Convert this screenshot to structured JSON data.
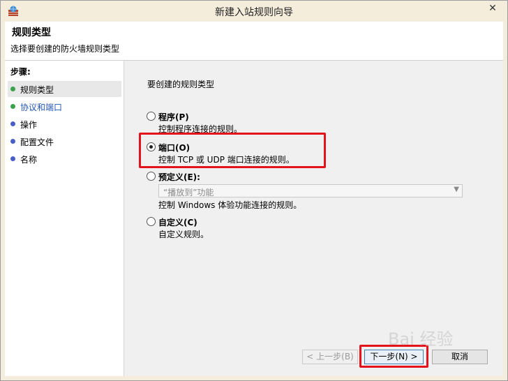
{
  "window": {
    "title": "新建入站规则向导",
    "close_glyph": "✕"
  },
  "header": {
    "title": "规则类型",
    "subtitle": "选择要创建的防火墙规则类型"
  },
  "steps": {
    "title": "步骤:",
    "items": [
      {
        "label": "规则类型",
        "dot_color": "#3aa24a"
      },
      {
        "label": "协议和端口",
        "dot_color": "#3aa24a"
      },
      {
        "label": "操作",
        "dot_color": "#4a5ec8"
      },
      {
        "label": "配置文件",
        "dot_color": "#4a5ec8"
      },
      {
        "label": "名称",
        "dot_color": "#4a5ec8"
      }
    ]
  },
  "main": {
    "heading": "要创建的规则类型",
    "options": [
      {
        "label": "程序(P)",
        "desc": "控制程序连接的规则。",
        "selected": false
      },
      {
        "label": "端口(O)",
        "desc": "控制 TCP 或 UDP 端口连接的规则。",
        "selected": true
      },
      {
        "label": "预定义(E):",
        "desc": "控制 Windows 体验功能连接的规则。",
        "selected": false
      },
      {
        "label": "自定义(C)",
        "desc": "自定义规则。",
        "selected": false
      }
    ],
    "predefined_select": {
      "value": "“播放到”功能"
    }
  },
  "buttons": {
    "back": "< 上一步(B)",
    "next": "下一步(N) >",
    "cancel": "取消"
  },
  "watermark": "Bai 经验",
  "colors": {
    "highlight": "#e4121b"
  }
}
